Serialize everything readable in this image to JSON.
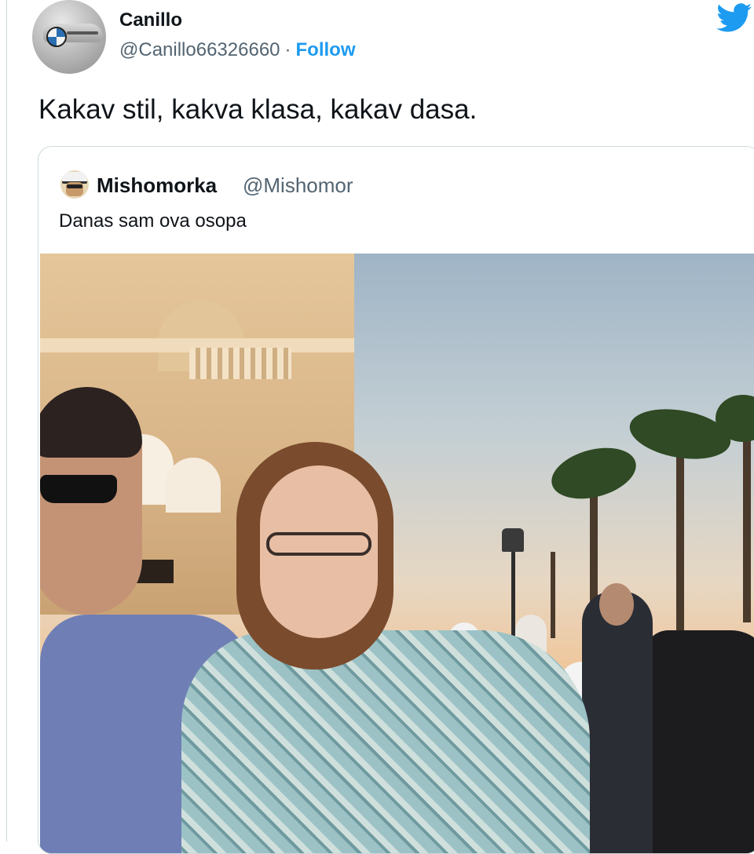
{
  "tweet": {
    "author_name": "Canillo",
    "author_handle": "@Canillo66326660",
    "separator": "·",
    "follow_label": "Follow",
    "text": "Kakav stil, kakva klasa, kakav dasa."
  },
  "quoted_tweet": {
    "author_name": "Mishomorka",
    "author_handle": "@Mishomor",
    "text": "Danas sam ova osopa",
    "media": "photo"
  },
  "icons": {
    "brand": "twitter-bird-icon",
    "brand_color": "#1d9bf0"
  },
  "colors": {
    "text_primary": "#0f1419",
    "text_secondary": "#536471",
    "accent": "#1d9bf0",
    "border": "#cfd9de"
  }
}
